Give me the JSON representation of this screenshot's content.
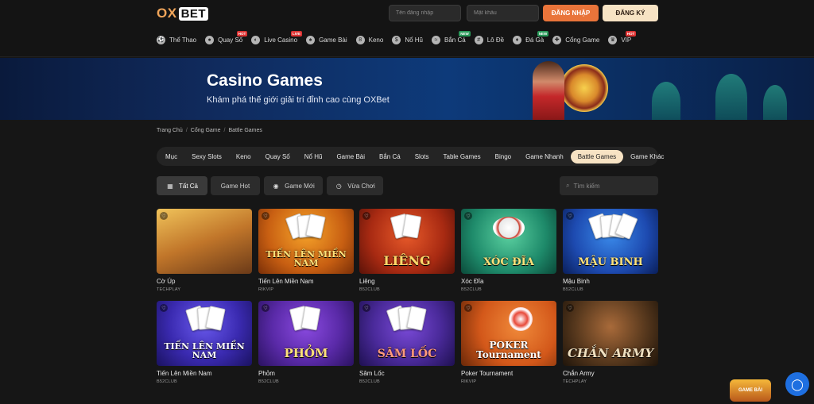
{
  "header": {
    "logo_left": "OX",
    "logo_right": "BET",
    "username_placeholder": "Tên đăng nhập",
    "password_placeholder": "Mật khẩu",
    "login_label": "ĐĂNG NHẬP",
    "register_label": "ĐĂNG KÝ"
  },
  "nav": {
    "items": [
      {
        "label": "Thể Thao",
        "icon": "soccer-ball-icon",
        "badge": ""
      },
      {
        "label": "Quay Số",
        "icon": "lottery-ball-icon",
        "badge": "HOT"
      },
      {
        "label": "Live Casino",
        "icon": "live-mask-icon",
        "badge": "LIVE"
      },
      {
        "label": "Game Bài",
        "icon": "spade-icon",
        "badge": ""
      },
      {
        "label": "Keno",
        "icon": "keno-icon",
        "badge": ""
      },
      {
        "label": "Nổ Hũ",
        "icon": "jackpot-icon",
        "badge": ""
      },
      {
        "label": "Bắn Cá",
        "icon": "fish-icon",
        "badge": "NEW"
      },
      {
        "label": "Lô Đề",
        "icon": "lottery-icon",
        "badge": ""
      },
      {
        "label": "Đá Gà",
        "icon": "rooster-icon",
        "badge": "NEW"
      },
      {
        "label": "Cổng Game",
        "icon": "gamepad-icon",
        "badge": ""
      },
      {
        "label": "VIP",
        "icon": "crown-icon",
        "badge": "HOT"
      }
    ]
  },
  "banner": {
    "title": "Casino Games",
    "subtitle": "Khám phá thế giới giải trí đỉnh cao cùng OXBet"
  },
  "breadcrumb": {
    "home": "Trang Chủ",
    "section": "Cổng Game",
    "current": "Battle Games"
  },
  "categories": {
    "items": [
      "Mục",
      "Sexy Slots",
      "Keno",
      "Quay Số",
      "Nổ Hũ",
      "Game Bài",
      "Bắn Cá",
      "Slots",
      "Table Games",
      "Bingo",
      "Game Nhanh",
      "Battle Games",
      "Game Khác"
    ],
    "active": "Battle Games"
  },
  "filters": {
    "all": "Tất Cả",
    "hot": "Game Hot",
    "new": "Game Mới",
    "recent": "Vừa Chơi",
    "search_placeholder": "Tìm kiếm"
  },
  "games": {
    "row1": [
      {
        "name": "Cờ Úp",
        "provider": "TECHPLAY",
        "art": "",
        "bg": "#c98a2e"
      },
      {
        "name": "Tiến Lên Miền Nam",
        "provider": "RIKVIP",
        "art": "TIẾN LÊN MIỀN NAM",
        "bg": "#d98a1f"
      },
      {
        "name": "Liêng",
        "provider": "B52CLUB",
        "art": "LIÊNG",
        "bg": "#b83a1a"
      },
      {
        "name": "Xóc Đĩa",
        "provider": "B52CLUB",
        "art": "XÓC ĐĨA",
        "bg": "#2a9a7a"
      },
      {
        "name": "Mậu Binh",
        "provider": "B52CLUB",
        "art": "MẬU BINH",
        "bg": "#1d55b8"
      }
    ],
    "row2": [
      {
        "name": "Tiến Lên Miền Nam",
        "provider": "B52CLUB",
        "art": "TIẾN LÊN MIỀN NAM",
        "bg": "#3d2ab0"
      },
      {
        "name": "Phỏm",
        "provider": "B52CLUB",
        "art": "PHỎM",
        "bg": "#5a2aa8"
      },
      {
        "name": "Sâm Lốc",
        "provider": "B52CLUB",
        "art": "SÂM LỐC",
        "bg": "#4a2a9a"
      },
      {
        "name": "Poker Tournament",
        "provider": "RIKVIP",
        "art": "POKER Tournament",
        "bg": "#d3581a"
      },
      {
        "name": "Chắn Army",
        "provider": "TECHPLAY",
        "art": "CHẮN ARMY",
        "bg": "#3a2a1a"
      }
    ]
  },
  "widgets": {
    "promo_label": "GAME BÀI",
    "chat_icon": "chat-bubble-icon"
  }
}
